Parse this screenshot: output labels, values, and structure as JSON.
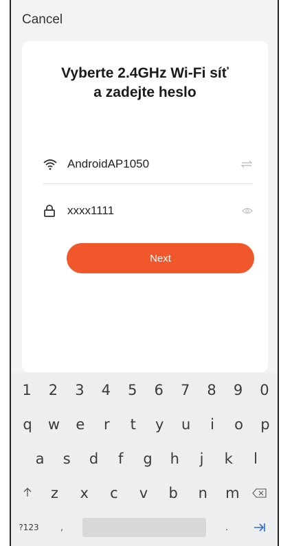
{
  "header": {
    "cancel_label": "Cancel"
  },
  "card": {
    "title_line1": "Vyberte 2.4GHz Wi-Fi síť",
    "title_line2": "a zadejte heslo",
    "ssid": "AndroidAP1050",
    "password": "xxxx1111",
    "next_label": "Next"
  },
  "icons": {
    "wifi": "wifi-icon",
    "switch": "swap-icon",
    "lock": "lock-icon",
    "eye": "eye-icon"
  },
  "colors": {
    "accent": "#f0582b"
  },
  "keyboard": {
    "numbers": [
      "1",
      "2",
      "3",
      "4",
      "5",
      "6",
      "7",
      "8",
      "9",
      "0"
    ],
    "row1": [
      "q",
      "w",
      "e",
      "r",
      "t",
      "y",
      "u",
      "i",
      "o",
      "p"
    ],
    "row2": [
      "a",
      "s",
      "d",
      "f",
      "g",
      "h",
      "j",
      "k",
      "l"
    ],
    "row3": [
      "z",
      "x",
      "c",
      "v",
      "b",
      "n",
      "m"
    ],
    "symbols_label": "?123",
    "comma": ",",
    "period": "."
  }
}
